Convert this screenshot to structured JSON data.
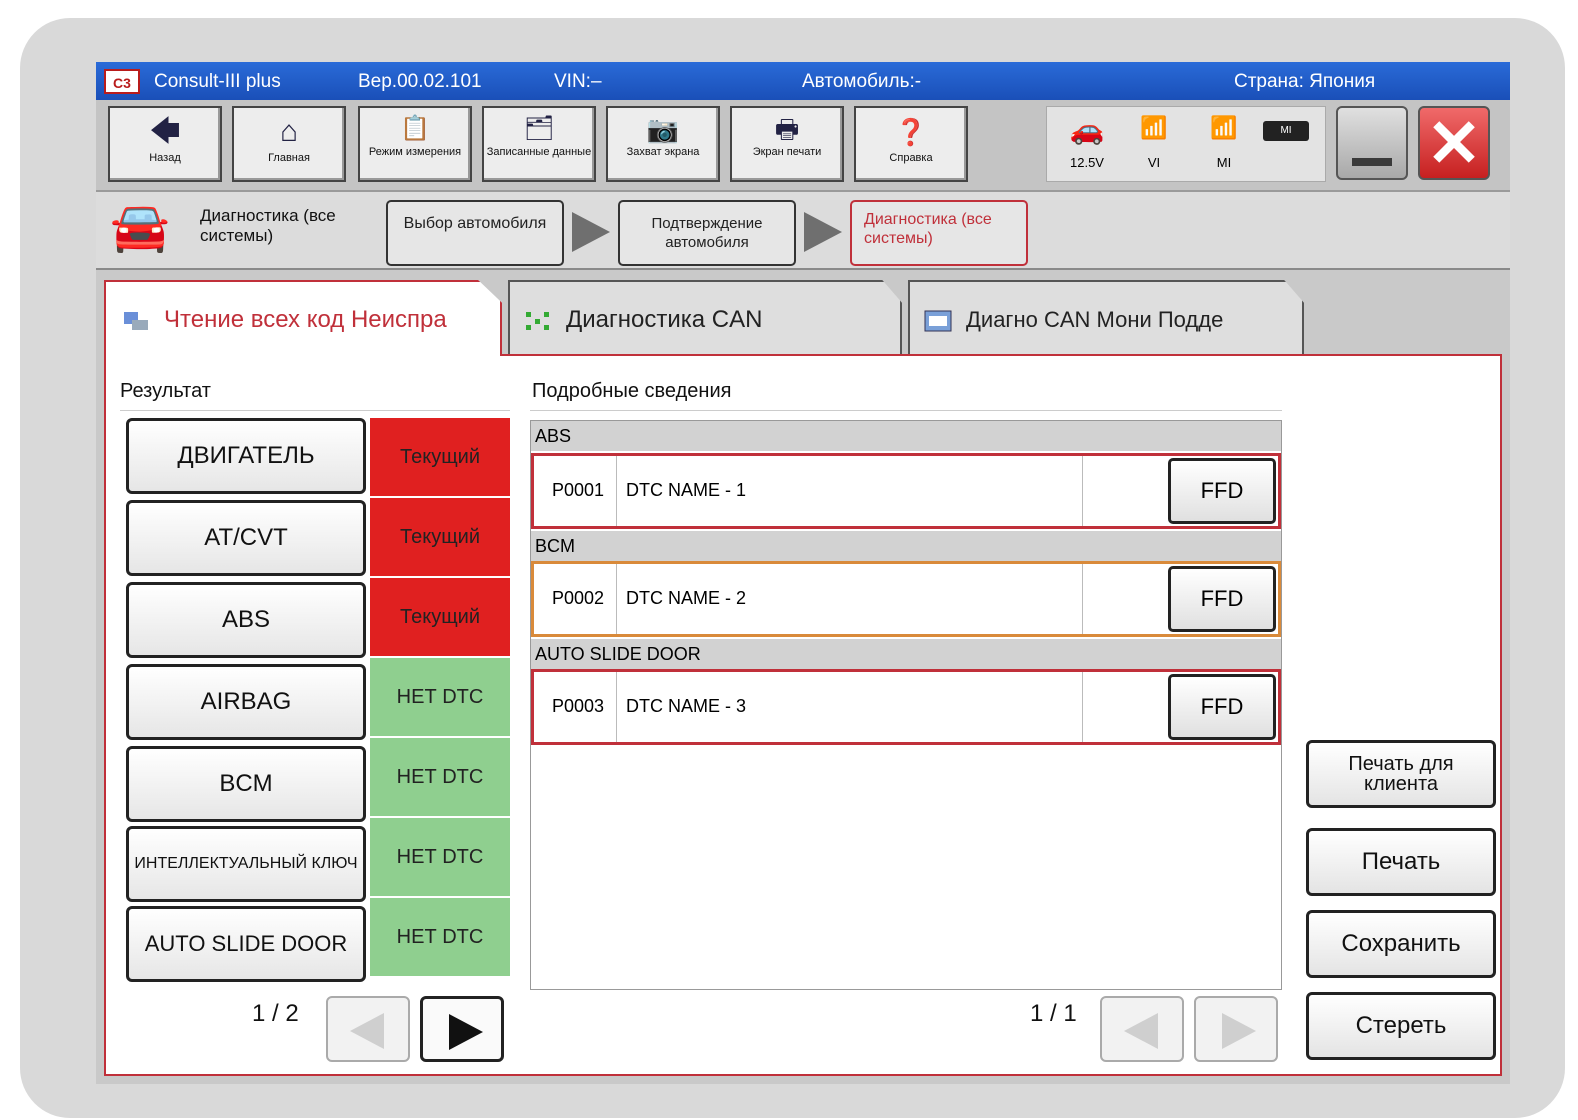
{
  "titlebar": {
    "app": "Consult-III plus",
    "version": "Вер.00.02.101",
    "vin": "VIN:–",
    "vehicle": "Автомобиль:-",
    "country": "Страна: Япония",
    "logo": "C3"
  },
  "toolbar": {
    "back": "Назад",
    "home": "Главная",
    "mode": "Режим измерения",
    "recorded": "Записанные данные",
    "capture": "Захват экрана",
    "print_screen": "Экран печати",
    "help": "Справка"
  },
  "status": {
    "voltage": "12.5V",
    "vi": "VI",
    "mi": "MI",
    "battery": "MI"
  },
  "breadcrumb": {
    "title": "Диагностика (все системы)",
    "step1": "Выбор автомобиля",
    "step2": "Подтверждение автомобиля",
    "step3": "Диагностика (все системы)"
  },
  "tabs": [
    {
      "label": "Чтение всех код Неиспра"
    },
    {
      "label": "Диагностика CAN"
    },
    {
      "label": "Диагно CAN Мони Подде"
    }
  ],
  "results": {
    "label": "Результат",
    "systems": [
      {
        "name": "ДВИГАТЕЛЬ",
        "status": "Текущий",
        "color": "#e02020"
      },
      {
        "name": "AT/CVT",
        "status": "Текущий",
        "color": "#e02020"
      },
      {
        "name": "ABS",
        "status": "Текущий",
        "color": "#e02020"
      },
      {
        "name": "AIRBAG",
        "status": "НЕТ DTC",
        "color": "#8fcf8f"
      },
      {
        "name": "BCM",
        "status": "НЕТ DTC",
        "color": "#8fcf8f"
      },
      {
        "name": "ИНТЕЛЛЕКТУАЛЬНЫЙ КЛЮЧ",
        "status": "НЕТ DTC",
        "color": "#8fcf8f"
      },
      {
        "name": "AUTO SLIDE DOOR",
        "status": "НЕТ DTC",
        "color": "#8fcf8f"
      }
    ],
    "page": "1 / 2"
  },
  "details": {
    "label": "Подробные сведения",
    "groups": [
      {
        "name": "ABS",
        "code": "P0001",
        "dtc": "DTC NAME - 1",
        "btn": "FFD"
      },
      {
        "name": "BCM",
        "code": "P0002",
        "dtc": "DTC NAME - 2",
        "btn": "FFD"
      },
      {
        "name": "AUTO SLIDE DOOR",
        "code": "P0003",
        "dtc": "DTC NAME - 3",
        "btn": "FFD"
      }
    ],
    "page": "1 / 1"
  },
  "actions": {
    "print_client": "Печать для клиента",
    "print": "Печать",
    "save": "Сохранить",
    "erase": "Стереть"
  }
}
